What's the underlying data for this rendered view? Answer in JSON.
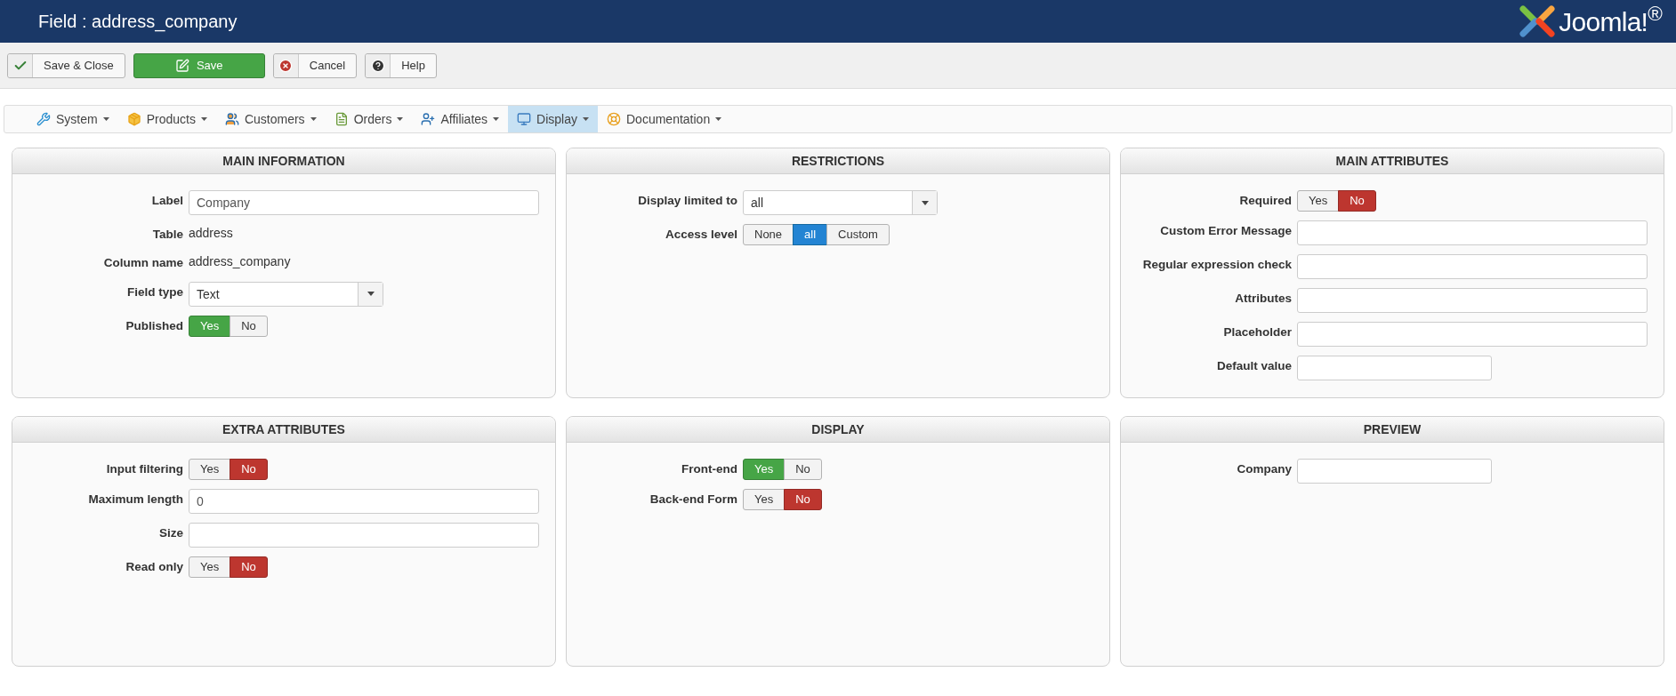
{
  "window": {
    "title": "Field : address_company"
  },
  "logo": {
    "text": "Joomla!$^{®}$"
  },
  "toolbar": [
    {
      "label": "Save & Close",
      "kind": "default"
    },
    {
      "label": "Save",
      "kind": "primary"
    },
    {
      "label": "Cancel",
      "kind": "default"
    },
    {
      "label": "Help",
      "kind": "default"
    }
  ],
  "menu": [
    {
      "label": "System",
      "selected": false
    },
    {
      "label": "Products",
      "selected": false
    },
    {
      "label": "Customers",
      "selected": false
    },
    {
      "label": "Orders",
      "selected": false
    },
    {
      "label": "Affiliates",
      "selected": false
    },
    {
      "label": "Display",
      "selected": true
    },
    {
      "label": "Documentation",
      "selected": false
    }
  ],
  "panels": [
    {
      "title": "MAIN INFORMATION",
      "fields": [
        {
          "label": "Label",
          "kind": "text",
          "value": "Company"
        },
        {
          "label": "Table",
          "kind": "static",
          "value": "address"
        },
        {
          "label": "Column name",
          "kind": "static",
          "value": "address_company"
        },
        {
          "label": "Field type",
          "kind": "select",
          "value": "Text"
        },
        {
          "label": "Published",
          "kind": "yesno",
          "options": [
            {
              "label": "Yes",
              "selected": true
            },
            {
              "label": "No",
              "selected": false
            }
          ]
        }
      ]
    },
    {
      "title": "RESTRICTIONS",
      "fields": [
        {
          "label": "Display limited to",
          "kind": "select",
          "value": "all"
        },
        {
          "label": "Access level",
          "kind": "choice",
          "options": [
            {
              "label": "None",
              "selected": false
            },
            {
              "label": "all",
              "selected": true
            },
            {
              "label": "Custom",
              "selected": false
            }
          ]
        }
      ]
    },
    {
      "title": "MAIN ATTRIBUTES",
      "fields": [
        {
          "label": "Required",
          "kind": "yesno",
          "options": [
            {
              "label": "Yes",
              "selected": false
            },
            {
              "label": "No",
              "selected": true
            }
          ]
        },
        {
          "label": "Custom Error Message",
          "kind": "text"
        },
        {
          "label": "Regular expression check",
          "kind": "text"
        },
        {
          "label": "Attributes",
          "kind": "text"
        },
        {
          "label": "Placeholder",
          "kind": "text"
        },
        {
          "label": "Default value",
          "kind": "short_text"
        }
      ]
    },
    {
      "title": "EXTRA ATTRIBUTES",
      "fields": [
        {
          "label": "Input filtering",
          "kind": "yesno",
          "options": [
            {
              "label": "Yes",
              "selected": false
            },
            {
              "label": "No",
              "selected": true
            }
          ]
        },
        {
          "label": "Maximum length",
          "kind": "text",
          "value": "0"
        },
        {
          "label": "Size",
          "kind": "text"
        },
        {
          "label": "Read only",
          "kind": "yesno",
          "options": [
            {
              "label": "Yes",
              "selected": false
            },
            {
              "label": "No",
              "selected": true
            }
          ]
        }
      ]
    },
    {
      "title": "DISPLAY",
      "fields": [
        {
          "label": "Front-end",
          "kind": "yesno",
          "options": [
            {
              "label": "Yes",
              "selected": true
            },
            {
              "label": "No",
              "selected": false
            }
          ]
        },
        {
          "label": "Back-end Form",
          "kind": "yesno",
          "options": [
            {
              "label": "Yes",
              "selected": false
            },
            {
              "label": "No",
              "selected": true
            }
          ]
        }
      ]
    },
    {
      "title": "PREVIEW",
      "fields": [
        {
          "label": "Company",
          "kind": "short_text"
        }
      ]
    }
  ]
}
